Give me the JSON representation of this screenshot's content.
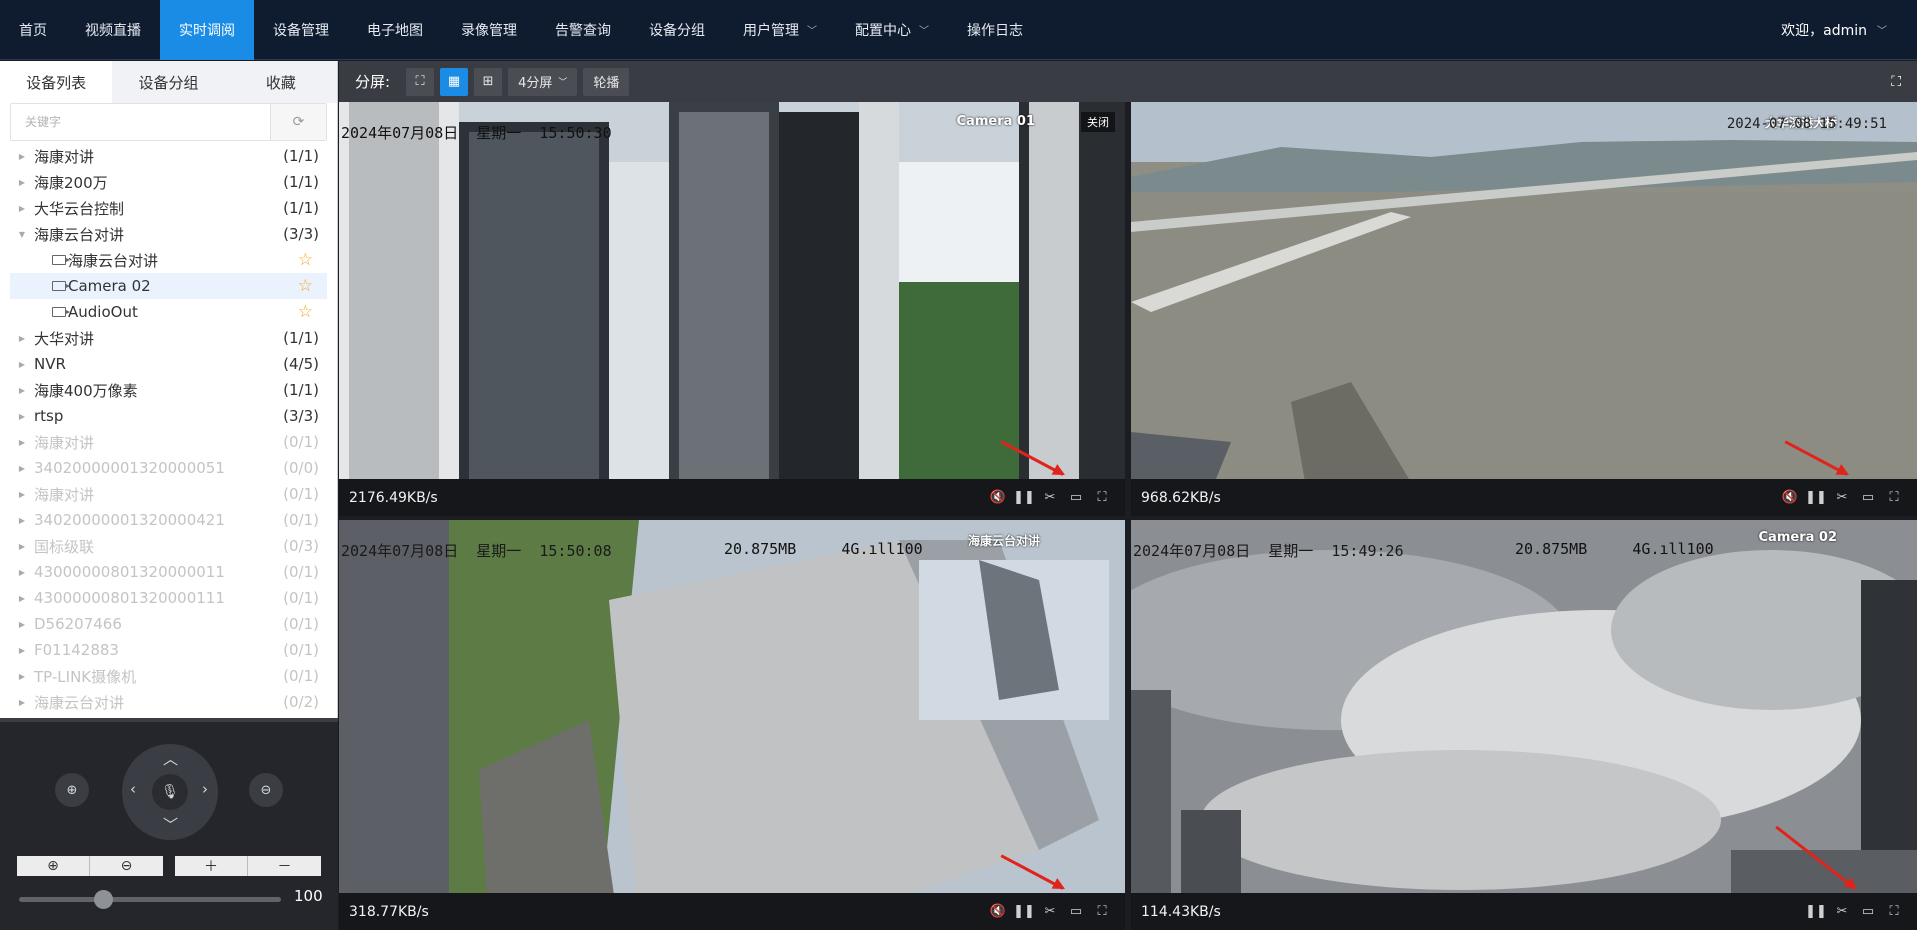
{
  "nav": {
    "items": [
      {
        "label": "首页",
        "active": false,
        "caret": false
      },
      {
        "label": "视频直播",
        "active": false,
        "caret": false
      },
      {
        "label": "实时调阅",
        "active": true,
        "caret": false
      },
      {
        "label": "设备管理",
        "active": false,
        "caret": false
      },
      {
        "label": "电子地图",
        "active": false,
        "caret": false
      },
      {
        "label": "录像管理",
        "active": false,
        "caret": false
      },
      {
        "label": "告警查询",
        "active": false,
        "caret": false
      },
      {
        "label": "设备分组",
        "active": false,
        "caret": false
      },
      {
        "label": "用户管理",
        "active": false,
        "caret": true
      },
      {
        "label": "配置中心",
        "active": false,
        "caret": true
      },
      {
        "label": "操作日志",
        "active": false,
        "caret": false
      }
    ],
    "user": "欢迎，admin"
  },
  "sidebar": {
    "tabs": [
      {
        "label": "设备列表",
        "active": true
      },
      {
        "label": "设备分组",
        "active": false
      },
      {
        "label": "收藏",
        "active": false
      }
    ],
    "search_placeholder": "关键字",
    "tree": [
      {
        "label": "海康对讲",
        "count": "(1/1)",
        "type": "group",
        "disabled": false,
        "expanded": false
      },
      {
        "label": "海康200万",
        "count": "(1/1)",
        "type": "group",
        "disabled": false,
        "expanded": false
      },
      {
        "label": "大华云台控制",
        "count": "(1/1)",
        "type": "group",
        "disabled": false,
        "expanded": false
      },
      {
        "label": "海康云台对讲",
        "count": "(3/3)",
        "type": "group",
        "disabled": false,
        "expanded": true
      },
      {
        "label": "海康云台对讲",
        "count": "",
        "type": "channel",
        "disabled": false,
        "selected": false
      },
      {
        "label": "Camera 02",
        "count": "",
        "type": "channel",
        "disabled": false,
        "selected": true
      },
      {
        "label": "AudioOut",
        "count": "",
        "type": "channel",
        "disabled": false,
        "selected": false
      },
      {
        "label": "大华对讲",
        "count": "(1/1)",
        "type": "group",
        "disabled": false,
        "expanded": false
      },
      {
        "label": "NVR",
        "count": "(4/5)",
        "type": "group",
        "disabled": false,
        "expanded": false
      },
      {
        "label": "海康400万像素",
        "count": "(1/1)",
        "type": "group",
        "disabled": false,
        "expanded": false
      },
      {
        "label": "rtsp",
        "count": "(3/3)",
        "type": "group",
        "disabled": false,
        "expanded": false
      },
      {
        "label": "海康对讲",
        "count": "(0/1)",
        "type": "group",
        "disabled": true,
        "expanded": false
      },
      {
        "label": "34020000001320000051",
        "count": "(0/0)",
        "type": "group",
        "disabled": true,
        "expanded": false
      },
      {
        "label": "海康对讲",
        "count": "(0/1)",
        "type": "group",
        "disabled": true,
        "expanded": false
      },
      {
        "label": "34020000001320000421",
        "count": "(0/1)",
        "type": "group",
        "disabled": true,
        "expanded": false
      },
      {
        "label": "国标级联",
        "count": "(0/3)",
        "type": "group",
        "disabled": true,
        "expanded": false
      },
      {
        "label": "43000000801320000011",
        "count": "(0/1)",
        "type": "group",
        "disabled": true,
        "expanded": false
      },
      {
        "label": "43000000801320000111",
        "count": "(0/1)",
        "type": "group",
        "disabled": true,
        "expanded": false
      },
      {
        "label": "D56207466",
        "count": "(0/1)",
        "type": "group",
        "disabled": true,
        "expanded": false
      },
      {
        "label": "F01142883",
        "count": "(0/1)",
        "type": "group",
        "disabled": true,
        "expanded": false
      },
      {
        "label": "TP-LINK摄像机",
        "count": "(0/1)",
        "type": "group",
        "disabled": true,
        "expanded": false
      },
      {
        "label": "海康云台对讲",
        "count": "(0/2)",
        "type": "group",
        "disabled": true,
        "expanded": false
      }
    ]
  },
  "ptz": {
    "slider_value": "100",
    "slider_fraction": 0.32
  },
  "toolbar": {
    "label": "分屏:",
    "layout_select": "4分屏",
    "carousel": "轮播"
  },
  "cells": [
    {
      "title": "Camera 01",
      "close": "关闭",
      "timestamp": "2024年07月08日  星期一  15:50:30",
      "rate": "2176.49KB/s",
      "selected": true,
      "controls": [
        "mute",
        "pause",
        "clip",
        "record",
        "fullscreen"
      ]
    },
    {
      "title": "大华深港大桥",
      "timestamp": "2024-07-08 15:49:51",
      "rate": "968.62KB/s",
      "selected": false,
      "controls": [
        "mute",
        "pause",
        "clip",
        "record",
        "fullscreen"
      ]
    },
    {
      "title": "海康云台对讲",
      "timestamp": "2024年07月08日  星期一  15:50:08",
      "overlay": "20.875MB     4G.ıll100",
      "rate": "318.77KB/s",
      "selected": false,
      "controls": [
        "mute",
        "pause",
        "clip",
        "record",
        "fullscreen"
      ]
    },
    {
      "title": "Camera 02",
      "timestamp": "2024年07月08日  星期一  15:49:26",
      "overlay": "20.875MB     4G.ıll100",
      "rate": "114.43KB/s",
      "selected": false,
      "controls": [
        "pause",
        "clip",
        "record",
        "fullscreen"
      ]
    }
  ],
  "colors": {
    "nav_bg": "#0f1c30",
    "accent": "#1a8ce6",
    "selected_border": "#d83a3a",
    "annotation_arrow": "#e0241b",
    "favorite_star": "#f5a623"
  }
}
